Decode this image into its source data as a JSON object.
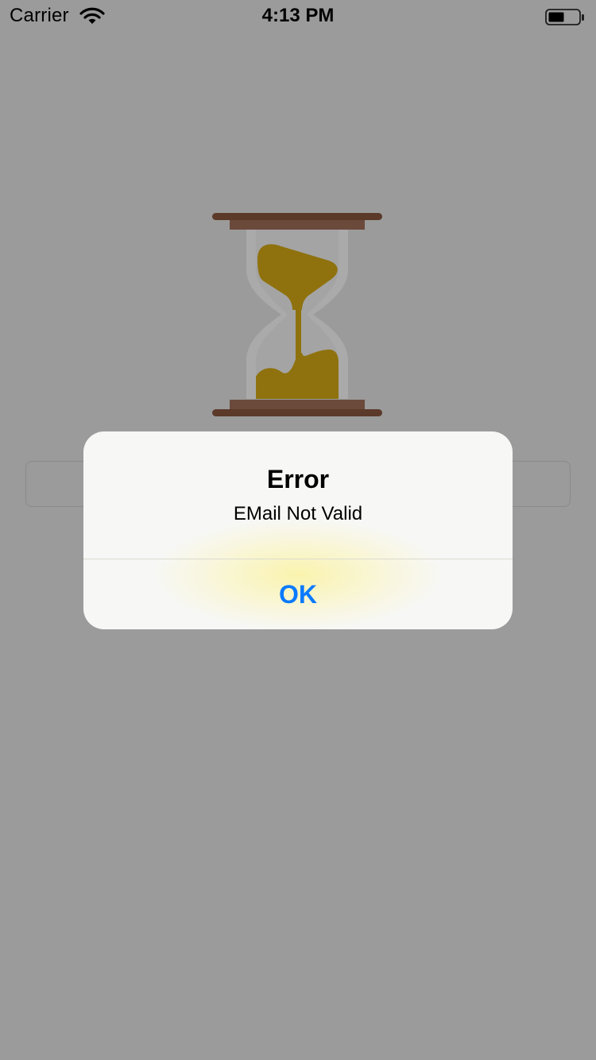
{
  "status_bar": {
    "carrier": "Carrier",
    "time": "4:13 PM",
    "wifi_icon": "wifi-icon",
    "battery_icon": "battery-icon"
  },
  "content": {
    "illustration": "hourglass-icon",
    "colors": {
      "overlay_background": "#9b9b9b",
      "hourglass_wood_dark": "#5c3a29",
      "hourglass_wood_light": "#6b4a3c",
      "hourglass_glass": "#aaaaaa",
      "hourglass_sand": "#8f720e"
    }
  },
  "alert": {
    "title": "Error",
    "message": "EMail Not Valid",
    "ok_label": "OK",
    "colors": {
      "background": "#f7f7f6",
      "button_text": "#0a7aff"
    }
  }
}
